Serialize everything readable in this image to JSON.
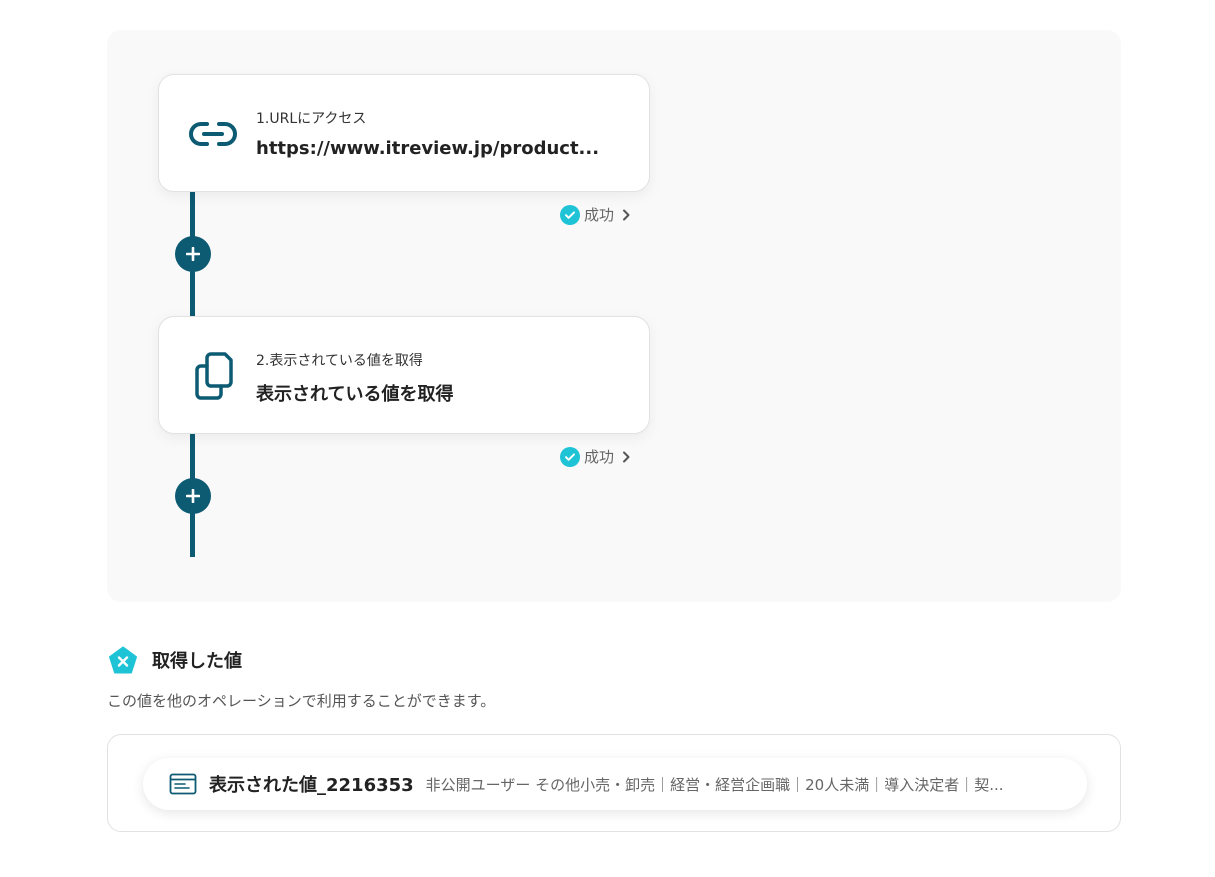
{
  "steps": [
    {
      "label": "1.URLにアクセス",
      "value": "https://www.itreview.jp/product...",
      "icon": "link-icon",
      "status": "成功"
    },
    {
      "label": "2.表示されている値を取得",
      "value": "表示されている値を取得",
      "icon": "copy-icon",
      "status": "成功"
    }
  ],
  "section": {
    "title": "取得した値",
    "description": "この値を他のオペレーションで利用することができます。"
  },
  "values": [
    {
      "name": "表示された値_2216353",
      "preview": "非公開ユーザー その他小売・卸売｜経営・経営企画職｜20人未満｜導入決定者｜契..."
    }
  ],
  "colors": {
    "accent": "#0c5b73",
    "success": "#1ec3d6",
    "panel_bg": "#f9f9f9"
  }
}
